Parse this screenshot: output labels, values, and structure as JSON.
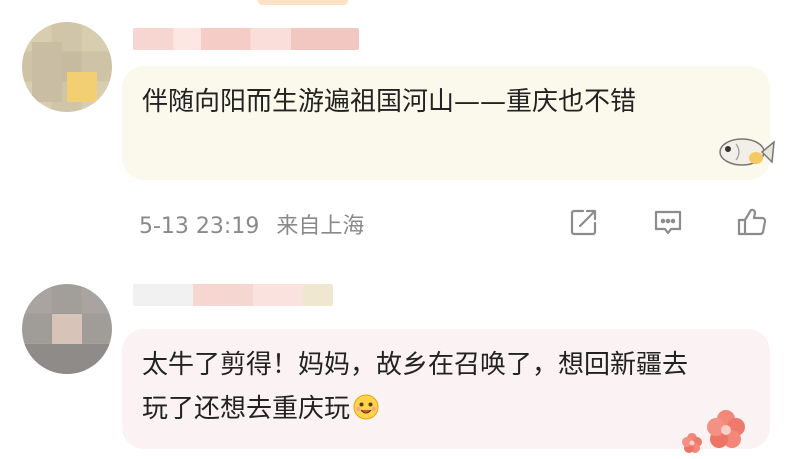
{
  "comments": [
    {
      "text": "伴随向阳而生游遍祖国河山——重庆也不错",
      "date": "5-13 23:19",
      "location": "来自上海",
      "bubble_color": "#fbf9ec",
      "sticker": "fish-sticker"
    },
    {
      "text": "太牛了剪得！妈妈，故乡在召唤了，想回新疆去玩了还想去重庆玩",
      "bubble_color": "#fbf2f3",
      "emoji": "happy-face-emoji",
      "sticker": "flower-sticker"
    }
  ],
  "icons": {
    "share": "share-icon",
    "comment": "comment-icon",
    "like": "thumbs-up-icon"
  },
  "colors": {
    "meta_text": "#8a8a8a",
    "icon_stroke": "#8c8c8c"
  }
}
